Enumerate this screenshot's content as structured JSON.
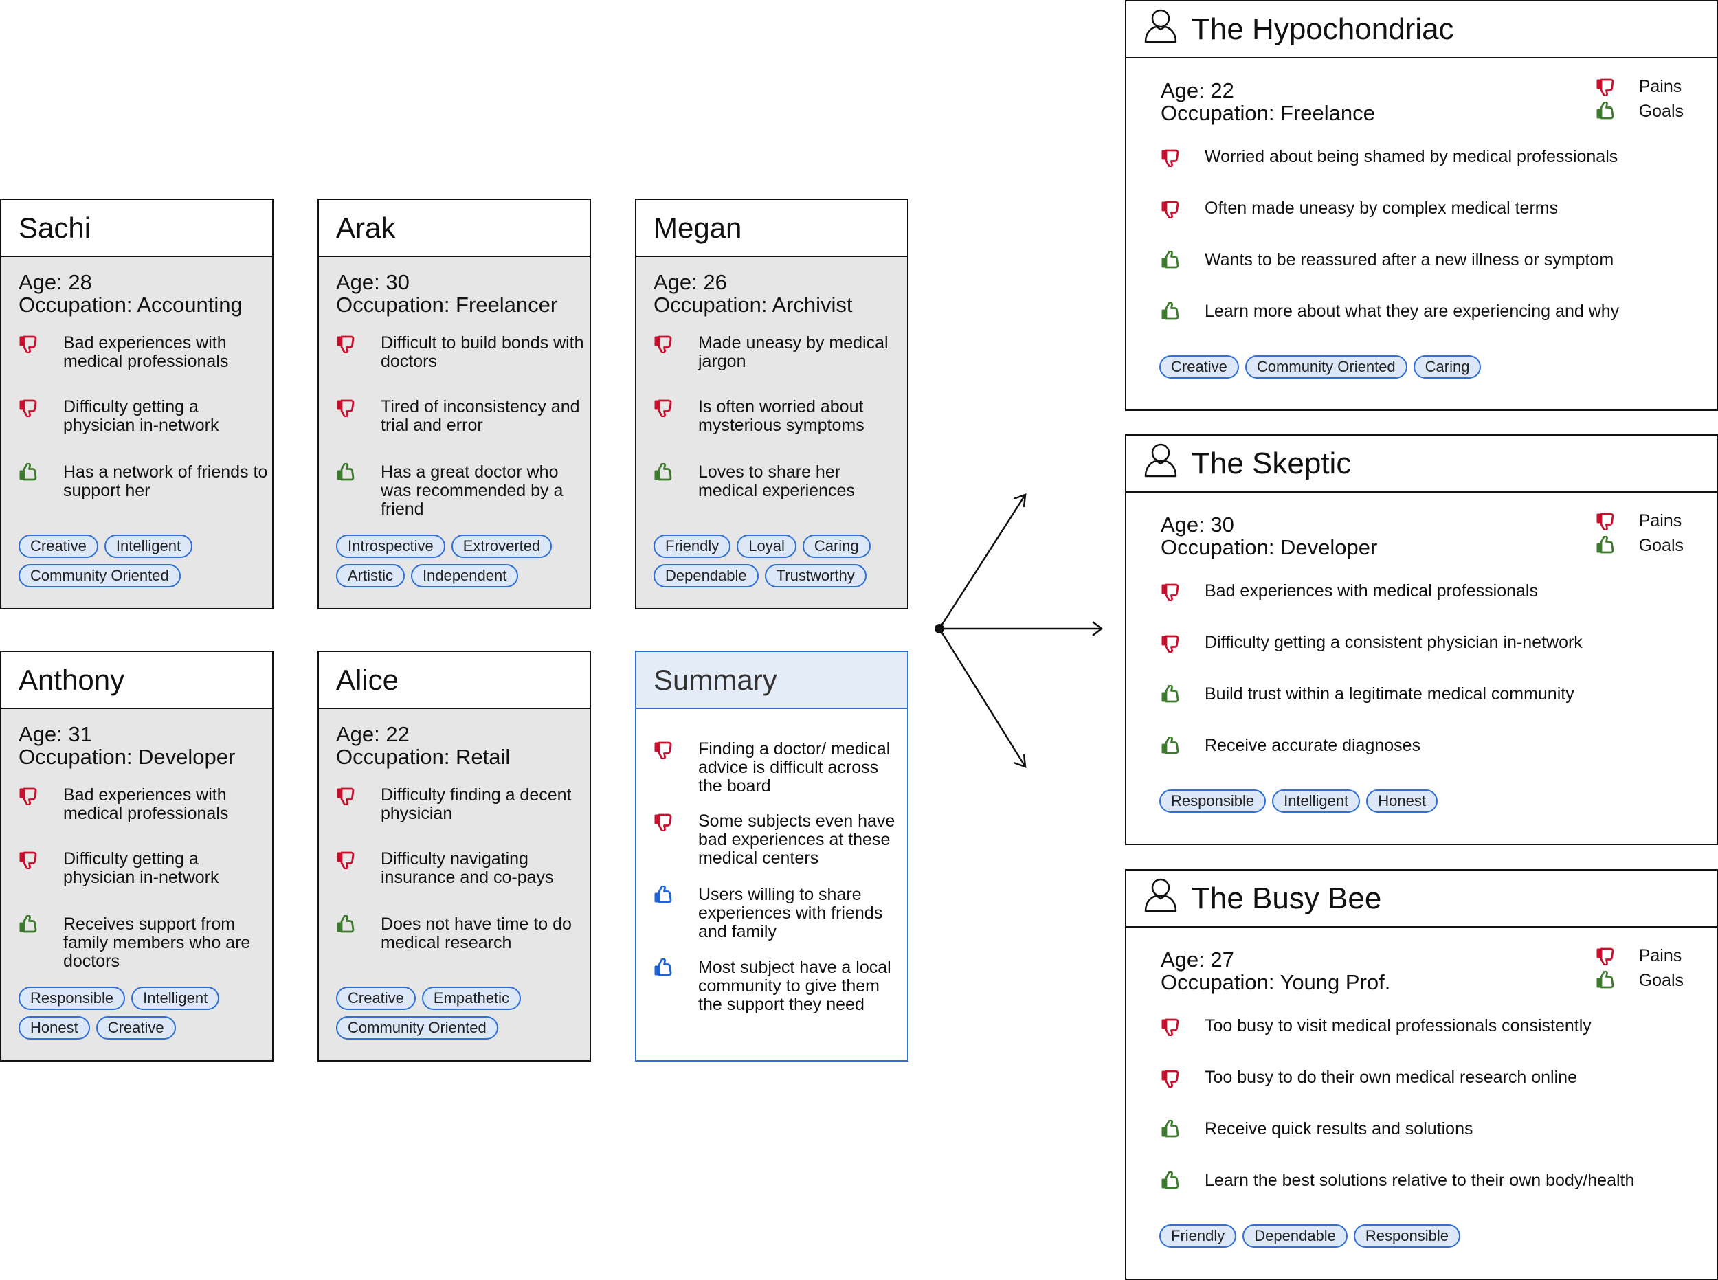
{
  "colors": {
    "pain": "#c8102e",
    "goal": "#3d7a2e",
    "summary_goal": "#1e63d6",
    "tag_border": "#2f6fd6",
    "tag_fill": "#dce7f7",
    "card_fill": "#e6e6e6",
    "summary_header": "#e4ecf8"
  },
  "cards": [
    {
      "name": "Sachi",
      "age": "Age: 28",
      "occupation": "Occupation: Accounting",
      "items": [
        {
          "type": "pain",
          "text": "Bad experiences with medical professionals"
        },
        {
          "type": "pain",
          "text": "Difficulty getting a physician in-network"
        },
        {
          "type": "goal",
          "text": "Has a network of friends to support her"
        }
      ],
      "tags": [
        "Creative",
        "Intelligent",
        "Community Oriented"
      ]
    },
    {
      "name": "Arak",
      "age": "Age: 30",
      "occupation": "Occupation: Freelancer",
      "items": [
        {
          "type": "pain",
          "text": "Difficult to build bonds with doctors"
        },
        {
          "type": "pain",
          "text": "Tired of inconsistency and trial and error"
        },
        {
          "type": "goal",
          "text": "Has a great doctor who was recommended by a friend"
        }
      ],
      "tags": [
        "Introspective",
        "Extroverted",
        "Artistic",
        "Independent"
      ]
    },
    {
      "name": "Megan",
      "age": "Age: 26",
      "occupation": "Occupation: Archivist",
      "items": [
        {
          "type": "pain",
          "text": "Made uneasy by medical jargon"
        },
        {
          "type": "pain",
          "text": "Is often worried about mysterious symptoms"
        },
        {
          "type": "goal",
          "text": "Loves to share her medical experiences"
        }
      ],
      "tags": [
        "Friendly",
        "Loyal",
        "Caring",
        "Dependable",
        "Trustworthy"
      ]
    },
    {
      "name": "Anthony",
      "age": "Age: 31",
      "occupation": "Occupation: Developer",
      "items": [
        {
          "type": "pain",
          "text": "Bad experiences with medical professionals"
        },
        {
          "type": "pain",
          "text": "Difficulty getting a physician in-network"
        },
        {
          "type": "goal",
          "text": "Receives support from family members who are doctors"
        }
      ],
      "tags": [
        "Responsible",
        "Intelligent",
        "Honest",
        "Creative"
      ]
    },
    {
      "name": "Alice",
      "age": "Age: 22",
      "occupation": "Occupation: Retail",
      "items": [
        {
          "type": "pain",
          "text": "Difficulty finding a decent physician"
        },
        {
          "type": "pain",
          "text": "Difficulty navigating insurance and co-pays"
        },
        {
          "type": "goal",
          "text": "Does not have time to do medical research"
        }
      ],
      "tags": [
        "Creative",
        "Empathetic",
        "Community Oriented"
      ]
    }
  ],
  "summary": {
    "title": "Summary",
    "items": [
      {
        "type": "pain",
        "text": "Finding a doctor/ medical advice is difficult across the board"
      },
      {
        "type": "pain",
        "text": "Some subjects even have bad experiences at these medical centers"
      },
      {
        "type": "goal",
        "text": "Users willing to share experiences with friends and family"
      },
      {
        "type": "goal",
        "text": "Most subject have a local community to give them the support they need"
      }
    ]
  },
  "legend": {
    "pains": "Pains",
    "goals": "Goals"
  },
  "personas": [
    {
      "title": "The Hypochondriac",
      "age": "Age: 22",
      "occupation": "Occupation: Freelance",
      "items": [
        {
          "type": "pain",
          "text": "Worried about being shamed by medical professionals"
        },
        {
          "type": "pain",
          "text": "Often made uneasy by complex medical terms"
        },
        {
          "type": "goal",
          "text": "Wants to be reassured after a new illness or symptom"
        },
        {
          "type": "goal",
          "text": "Learn more about what they are experiencing and why"
        }
      ],
      "tags": [
        "Creative",
        "Community Oriented",
        "Caring"
      ]
    },
    {
      "title": "The Skeptic",
      "age": "Age: 30",
      "occupation": "Occupation: Developer",
      "items": [
        {
          "type": "pain",
          "text": "Bad experiences with medical professionals"
        },
        {
          "type": "pain",
          "text": "Difficulty getting a consistent physician in-network"
        },
        {
          "type": "goal",
          "text": "Build trust within a legitimate medical community"
        },
        {
          "type": "goal",
          "text": "Receive accurate diagnoses"
        }
      ],
      "tags": [
        "Responsible",
        "Intelligent",
        "Honest"
      ]
    },
    {
      "title": "The Busy Bee",
      "age": "Age: 27",
      "occupation": "Occupation: Young Prof.",
      "items": [
        {
          "type": "pain",
          "text": "Too busy to visit medical professionals consistently"
        },
        {
          "type": "pain",
          "text": "Too busy to do their own medical research online"
        },
        {
          "type": "goal",
          "text": "Receive quick results and solutions"
        },
        {
          "type": "goal",
          "text": "Learn the best solutions relative to their own body/health"
        }
      ],
      "tags": [
        "Friendly",
        "Dependable",
        "Responsible"
      ]
    }
  ]
}
